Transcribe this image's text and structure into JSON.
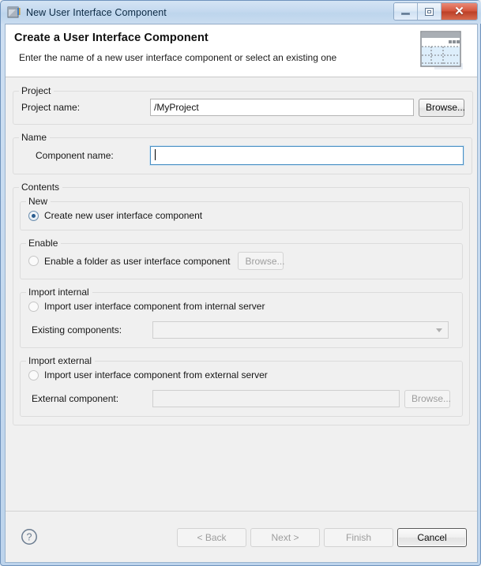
{
  "window": {
    "title": "New User Interface Component",
    "icon": "component-window-icon",
    "controls": {
      "minimize": "minimize-icon",
      "maximize": "maximize-icon",
      "close": "close-icon",
      "close_glyph": "✕"
    }
  },
  "banner": {
    "title": "Create a User Interface Component",
    "subtitle": "Enter the name of a new user interface component or select an existing one",
    "icon": "form-layout-icon"
  },
  "project_group": {
    "legend": "Project",
    "name_label": "Project name:",
    "name_value": "/MyProject",
    "name_placeholder": "",
    "browse_label": "Browse...",
    "browse_enabled": true
  },
  "name_group": {
    "legend": "Name",
    "component_label": "Component name:",
    "component_value": "",
    "component_placeholder": "",
    "focused": true
  },
  "contents_group": {
    "legend": "Contents",
    "new_group": {
      "legend": "New",
      "radio_label": "Create new user interface component",
      "selected": true
    },
    "enable_group": {
      "legend": "Enable",
      "radio_label": "Enable a folder as user interface component",
      "selected": false,
      "browse_label": "Browse...",
      "browse_enabled": false
    },
    "import_internal_group": {
      "legend": "Import internal",
      "radio_label": "Import user interface component from internal server",
      "selected": false,
      "combo_label": "Existing components:",
      "combo_value": "",
      "combo_icon": "chevron-down-icon"
    },
    "import_external_group": {
      "legend": "Import external",
      "radio_label": "Import user interface component from external server",
      "selected": false,
      "field_label": "External component:",
      "field_value": "",
      "browse_label": "Browse...",
      "browse_enabled": false
    }
  },
  "footer": {
    "help_icon": "help-question-icon",
    "back_label": "< Back",
    "back_enabled": false,
    "next_label": "Next >",
    "next_enabled": false,
    "finish_label": "Finish",
    "finish_enabled": false,
    "cancel_label": "Cancel",
    "cancel_enabled": true
  },
  "colors": {
    "titlebar": "#c4d9ef",
    "frame_border": "#6f93bd",
    "body": "#f0f0f0",
    "banner": "#ffffff",
    "close_button": "#c4492f",
    "radio_selected": "#2a5d8f",
    "focus_border": "#4a90c4"
  }
}
